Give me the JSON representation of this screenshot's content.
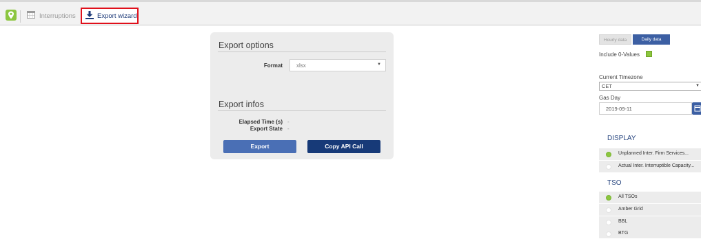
{
  "tabs": {
    "interruptions_label": "Interruptions",
    "export_wizard_label": "Export wizard"
  },
  "export_options": {
    "title": "Export options",
    "format_label": "Format",
    "format_value": "xlsx"
  },
  "export_infos": {
    "title": "Export infos",
    "elapsed_label": "Elapsed Time (s)",
    "elapsed_value": "-",
    "state_label": "Export State",
    "state_value": "-"
  },
  "actions": {
    "export_label": "Export",
    "copy_api_label": "Copy API Call"
  },
  "sidebar": {
    "hourly_label": "Hourly data",
    "daily_label": "Daily data",
    "include_zero_label": "Include 0-Values",
    "include_zero_checked": true,
    "timezone_label": "Current Timezone",
    "timezone_value": "CET",
    "gas_day_label": "Gas Day",
    "gas_day_value": "2019-09-11",
    "display_title": "DISPLAY",
    "display_options": [
      {
        "label": "Unplanned Inter. Firm Services...",
        "selected": true
      },
      {
        "label": "Actual Inter. Interruptible Capacity...",
        "selected": false
      }
    ],
    "tso_title": "TSO",
    "tso_options": [
      {
        "label": "All TSOs",
        "selected": true
      },
      {
        "label": "Amber Grid",
        "selected": false
      },
      {
        "label": "BBL",
        "selected": false
      },
      {
        "label": "BTG",
        "selected": false
      }
    ]
  },
  "colors": {
    "accent_green": "#8cc63f",
    "primary_blue": "#4a6fb5",
    "dark_blue": "#173a78",
    "highlight_red": "#e0101b"
  }
}
